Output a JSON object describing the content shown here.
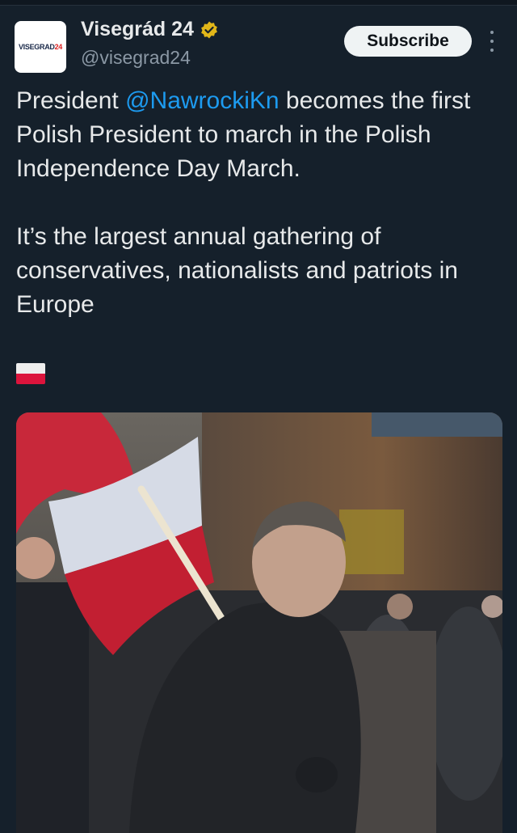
{
  "account": {
    "avatar_text_a": "VISEGRAD",
    "avatar_text_b": "24",
    "display_name": "Visegrád 24",
    "handle": "@visegrad24",
    "verified": true
  },
  "actions": {
    "subscribe_label": "Subscribe",
    "more_icon": "vertical-ellipsis-icon"
  },
  "tweet": {
    "line1_pre": "President ",
    "mention": "@NawrockiKn",
    "line1_post": " becomes the first Polish President to march in the Polish Independence Day March.",
    "paragraph2": "It’s the largest annual gathering of conservatives, nationalists and patriots in Europe",
    "emoji": "polish-flag-emoji"
  },
  "colors": {
    "background": "#15202b",
    "text": "#e7e9ea",
    "secondary": "#8b98a5",
    "link": "#1d9bf0",
    "verified_badge": "#e2b719",
    "flag_white": "#eeeeee",
    "flag_red": "#dc143c"
  }
}
